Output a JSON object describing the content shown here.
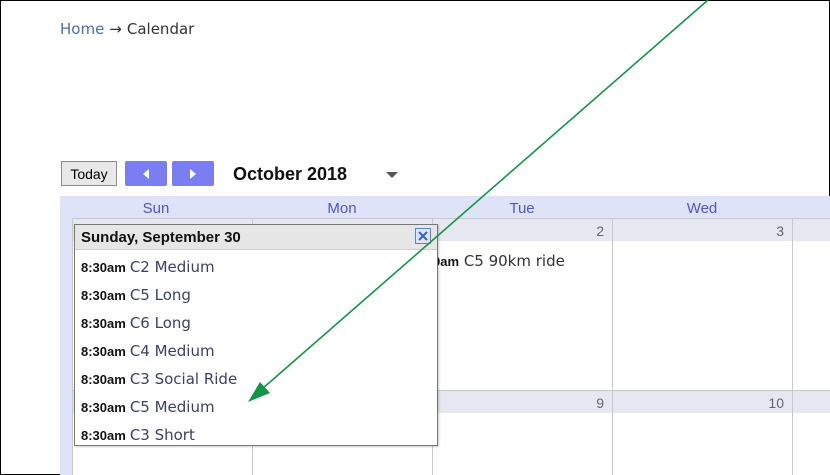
{
  "breadcrumb": {
    "home": "Home",
    "separator": "→",
    "current": "Calendar"
  },
  "toolbar": {
    "today_label": "Today",
    "prev_icon": "chevron-left-icon",
    "next_icon": "chevron-right-icon",
    "month_title": "October 2018",
    "month_dropdown_icon": "caret-down-icon",
    "nav_color": "#7b7ef0"
  },
  "calendar": {
    "days": [
      "Sun",
      "Mon",
      "Tue",
      "Wed"
    ],
    "week1": {
      "tue": "2",
      "wed": "3"
    },
    "week2": {
      "tue": "9",
      "wed": "10"
    },
    "tuesday_event": {
      "time": "9am",
      "title": "C5 90km ride"
    },
    "header_color": "#4f56c9"
  },
  "popup": {
    "title": "Sunday, September 30",
    "close_icon": "close-icon",
    "events": [
      {
        "time": "8:30am",
        "title": "C2 Medium"
      },
      {
        "time": "8:30am",
        "title": "C5 Long"
      },
      {
        "time": "8:30am",
        "title": "C6 Long"
      },
      {
        "time": "8:30am",
        "title": "C4 Medium"
      },
      {
        "time": "8:30am",
        "title": "C3 Social Ride"
      },
      {
        "time": "8:30am",
        "title": "C5 Medium"
      },
      {
        "time": "8:30am",
        "title": "C3 Short"
      }
    ]
  },
  "annotation": {
    "arrow_color": "#159447",
    "arrow_icon": "annotation-arrow-icon"
  }
}
